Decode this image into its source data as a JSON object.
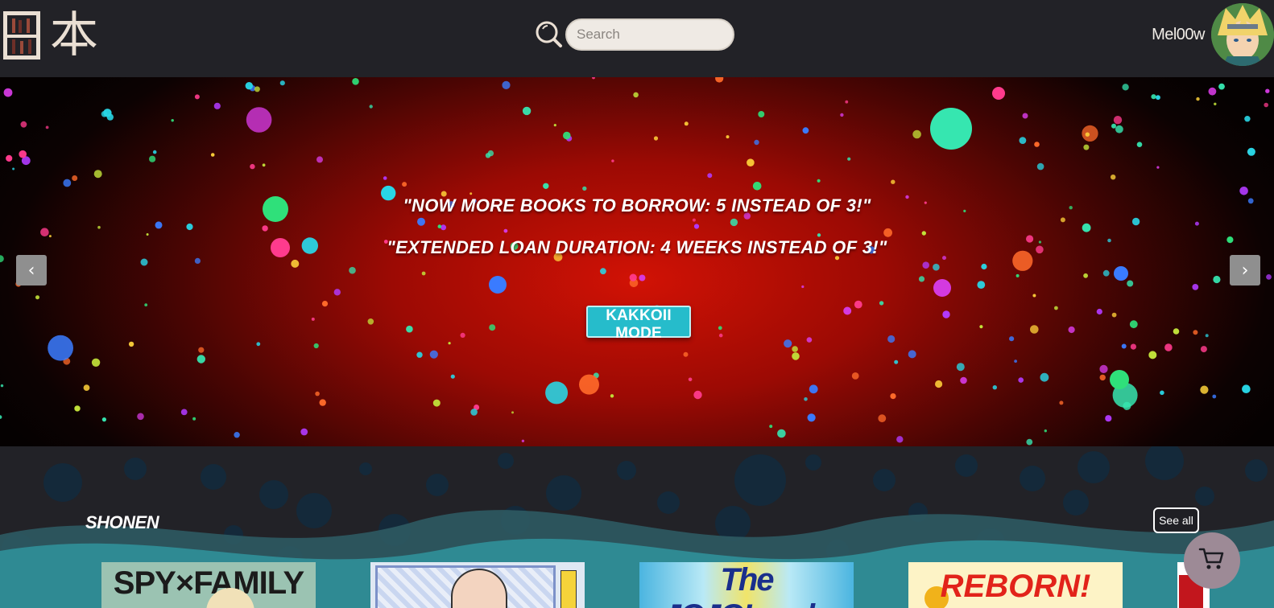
{
  "header": {
    "logo_kanji": "本",
    "search": {
      "placeholder": "Search",
      "value": "",
      "icon": "search-icon"
    },
    "user": {
      "name": "Mel00w",
      "avatar_icon": "user-avatar"
    }
  },
  "hero": {
    "line1": "\"NOW MORE BOOKS TO BORROW: 5 INSTEAD OF 3!\"",
    "line2": "\"EXTENDED LOAN DURATION: 4 WEEKS INSTEAD OF 3!\"",
    "button_label": "KAKKOII MODE",
    "prev_label": "‹",
    "next_label": "›"
  },
  "section": {
    "title": "SHONEN",
    "see_all_label": "See all",
    "covers": [
      {
        "title": "SPY×FAMILY"
      },
      {
        "title": ""
      },
      {
        "title": "The JOJOLands"
      },
      {
        "title": "REBORN!"
      }
    ]
  },
  "colors": {
    "header_bg": "#222227",
    "accent_button": "#26bccb",
    "hero_center": "#d11205",
    "logo_color": "#eadfd3",
    "cart_bg": "#9d8a96"
  }
}
